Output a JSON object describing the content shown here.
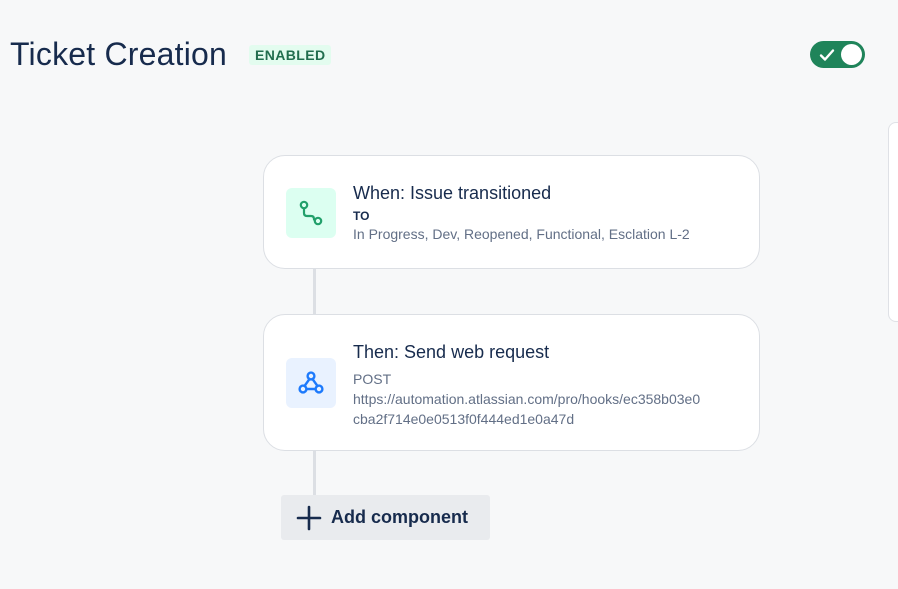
{
  "header": {
    "title": "Ticket Creation",
    "status_badge": "ENABLED"
  },
  "toggle": {
    "state": "on",
    "icon": "check-icon"
  },
  "trigger": {
    "title": "When: Issue transitioned",
    "label": "TO",
    "statuses": "In Progress, Dev, Reopened, Functional, Esclation L-2",
    "icon": "transition-icon"
  },
  "action": {
    "title": "Then: Send web request",
    "method": "POST",
    "url_line1": "https://automation.atlassian.com/pro/hooks/ec358b03e0",
    "url_line2": "cba2f714e0e0513f0f444ed1e0a47d",
    "icon": "webhook-icon"
  },
  "add_component": {
    "label": "Add component",
    "icon": "plus-icon"
  },
  "colors": {
    "toggle_on": "#1f845a",
    "badge_bg": "#e3fcef",
    "badge_text": "#216e4e",
    "trigger_icon_bg": "#dcfff1",
    "trigger_icon": "#22a06b",
    "action_icon_bg": "#e9f2ff",
    "action_icon": "#1d7afc"
  }
}
